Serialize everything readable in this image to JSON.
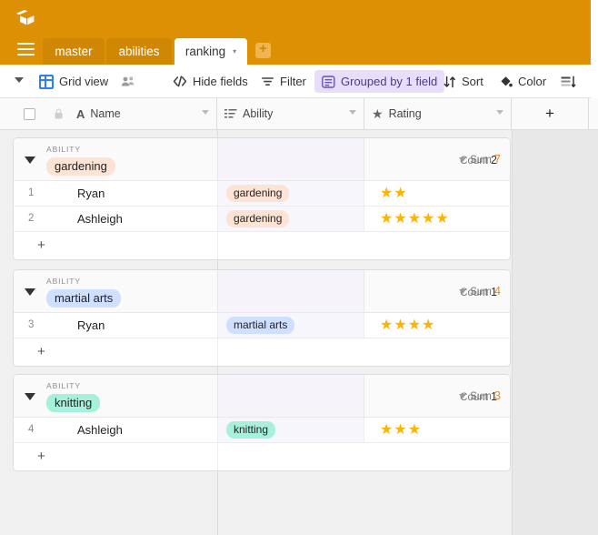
{
  "app": {
    "logo_icon": "airtable-logo-icon",
    "brand_color": "#dd9004",
    "accent_purple": "#e8ddfb",
    "star_color": "#fcb400"
  },
  "tabs": {
    "menu_icon": "hamburger-menu-icon",
    "items": [
      {
        "label": "master",
        "active": false
      },
      {
        "label": "abilities",
        "active": false
      },
      {
        "label": "ranking",
        "active": true
      }
    ],
    "active_caret": "▾",
    "add_tab_label": "+"
  },
  "toolbar": {
    "view_caret_icon": "chevron-down-icon",
    "grid_icon": "grid-view-icon",
    "view_name": "Grid view",
    "collaborators_icon": "collaborators-icon",
    "hide_fields_icon": "hide-fields-icon",
    "hide_fields_label": "Hide fields",
    "filter_icon": "filter-icon",
    "filter_label": "Filter",
    "group_icon": "group-icon",
    "group_label": "Grouped by 1 field",
    "sort_icon": "sort-icon",
    "sort_label": "Sort",
    "color_icon": "color-icon",
    "color_label": "Color",
    "row_height_icon": "row-height-icon"
  },
  "columns": {
    "select_all_checkbox": "select-all-checkbox",
    "lock_icon": "lock-icon",
    "name": {
      "type_icon": "A",
      "label": "Name"
    },
    "ability": {
      "type_icon": "multi-select-icon",
      "label": "Ability"
    },
    "rating": {
      "type_icon": "★",
      "label": "Rating"
    },
    "add_field_label": "+"
  },
  "groups": [
    {
      "field_label": "ABILITY",
      "value": "gardening",
      "pill_bg": "#fde3d4",
      "count_label": "Count",
      "count_value": "2",
      "sum_label": "Sum",
      "sum_value": "7",
      "rows": [
        {
          "num": "1",
          "name": "Ryan",
          "ability": "gardening",
          "rating": 2
        },
        {
          "num": "2",
          "name": "Ashleigh",
          "ability": "gardening",
          "rating": 5
        }
      ],
      "add_row_label": "+"
    },
    {
      "field_label": "ABILITY",
      "value": "martial arts",
      "pill_bg": "#cfdfff",
      "count_label": "Count",
      "count_value": "1",
      "sum_label": "Sum",
      "sum_value": "4",
      "rows": [
        {
          "num": "3",
          "name": "Ryan",
          "ability": "martial arts",
          "rating": 4
        }
      ],
      "add_row_label": "+"
    },
    {
      "field_label": "ABILITY",
      "value": "knitting",
      "pill_bg": "#a6f0dc",
      "count_label": "Count",
      "count_value": "1",
      "sum_label": "Sum",
      "sum_value": "3",
      "rows": [
        {
          "num": "4",
          "name": "Ashleigh",
          "ability": "knitting",
          "rating": 3
        }
      ],
      "add_row_label": "+"
    }
  ]
}
